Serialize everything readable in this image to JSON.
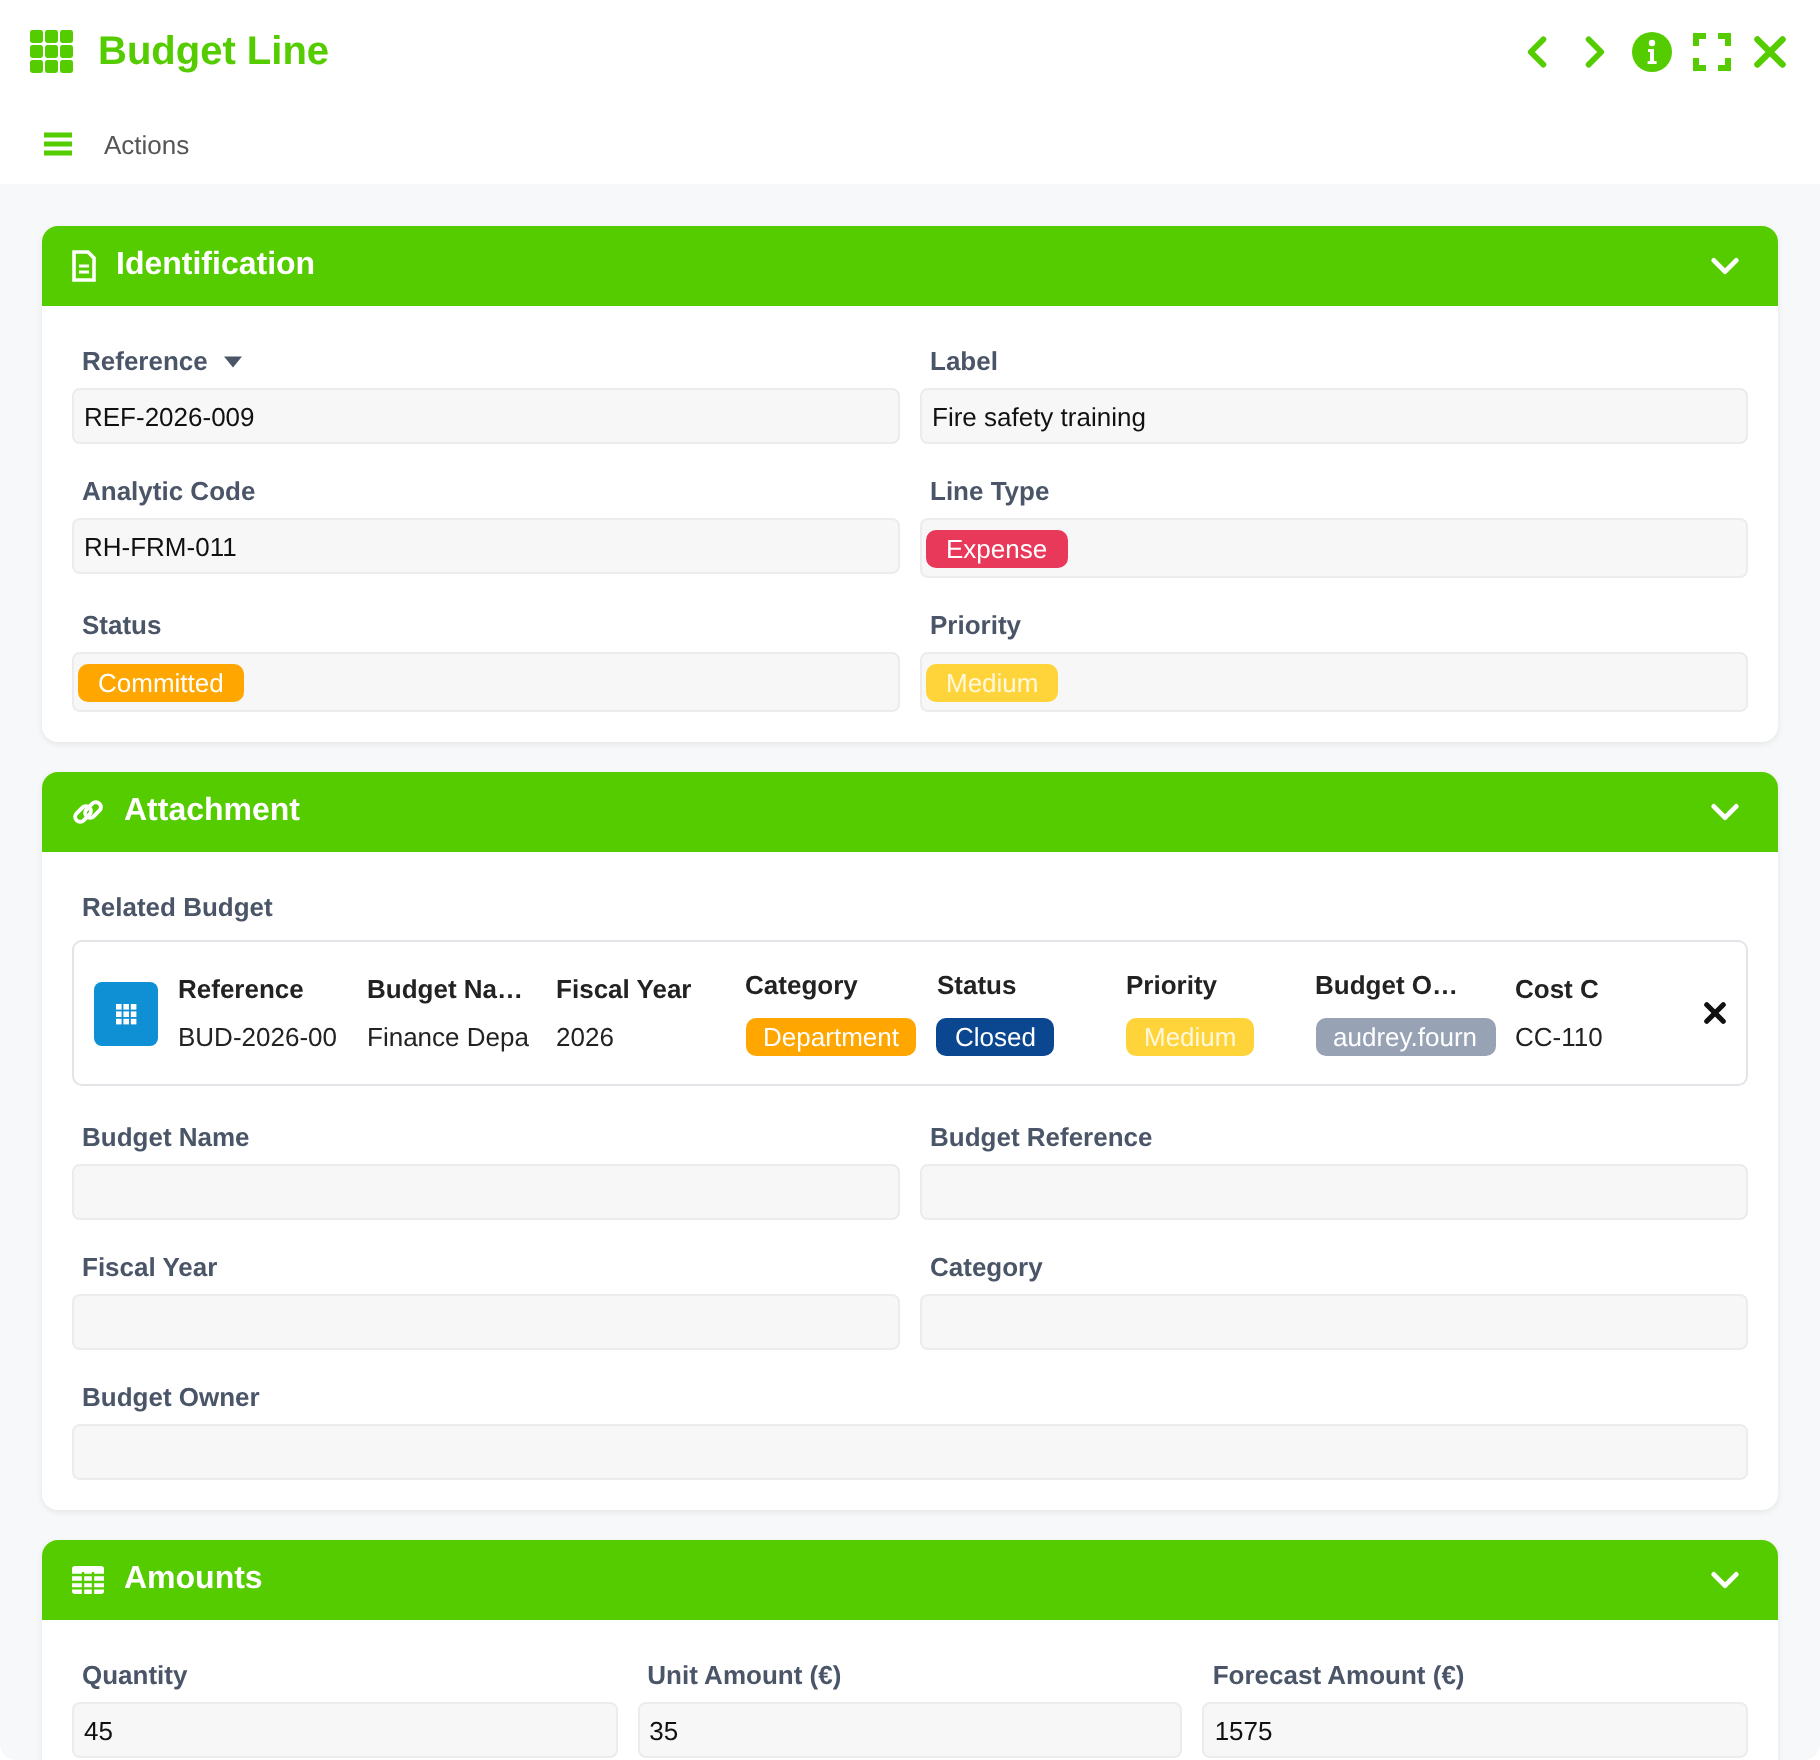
{
  "window": {
    "title": "Budget Line"
  },
  "toolbar": {
    "menu_label": "Actions"
  },
  "sections": [
    {
      "title": "Identification",
      "expanded": true,
      "fields": [
        {
          "label": "Reference",
          "kind": "text",
          "value": "REF-2026-009",
          "has_dropdown": true
        },
        {
          "label": "Label",
          "kind": "text",
          "value": "Fire safety training"
        },
        {
          "label": "Analytic Code",
          "kind": "text",
          "value": "RH-FRM-011"
        },
        {
          "label": "Line Type",
          "kind": "tag",
          "value": "Expense",
          "color": "#e8395a"
        },
        {
          "label": "Status",
          "kind": "tag",
          "value": "Committed",
          "color": "#ffa600"
        },
        {
          "label": "Priority",
          "kind": "tag",
          "value": "Medium",
          "color": "#ffd43b"
        }
      ]
    },
    {
      "title": "Attachment",
      "expanded": true,
      "related": {
        "label": "Related Budget",
        "columns": [
          {
            "heading": "Reference",
            "kind": "text",
            "value": "BUD-2026-00"
          },
          {
            "heading": "Budget Na…",
            "kind": "text",
            "value": "Finance Depa"
          },
          {
            "heading": "Fiscal Year",
            "kind": "text",
            "value": "2026"
          },
          {
            "heading": "Category",
            "kind": "tag",
            "value": "Department",
            "color": "#ffa600"
          },
          {
            "heading": "Status",
            "kind": "tag",
            "value": "Closed",
            "color": "#0b4690"
          },
          {
            "heading": "Priority",
            "kind": "tag",
            "value": "Medium",
            "color": "#ffd43b"
          },
          {
            "heading": "Budget O…",
            "kind": "tag",
            "value": "audrey.fourn",
            "color": "#97a3b4"
          },
          {
            "heading": "Cost C",
            "kind": "text",
            "value": "CC-110"
          }
        ]
      },
      "fields": [
        {
          "label": "Budget Name",
          "kind": "empty"
        },
        {
          "label": "Budget Reference",
          "kind": "empty"
        },
        {
          "label": "Fiscal Year",
          "kind": "empty"
        },
        {
          "label": "Category",
          "kind": "empty"
        },
        {
          "label": "Budget Owner",
          "kind": "empty"
        }
      ]
    },
    {
      "title": "Amounts",
      "expanded": true,
      "fields": [
        {
          "label": "Quantity",
          "kind": "text",
          "value": "45"
        },
        {
          "label": "Unit Amount (€)",
          "kind": "text",
          "value": "35"
        },
        {
          "label": "Forecast Amount (€)",
          "kind": "text",
          "value": "1575"
        }
      ]
    }
  ]
}
